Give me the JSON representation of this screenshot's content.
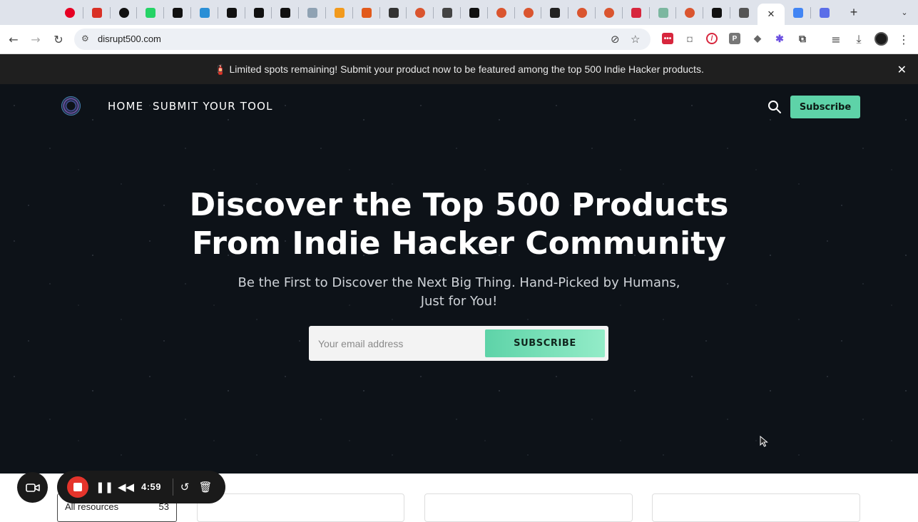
{
  "browser": {
    "tabs": [
      {
        "icon": "pinterest-tab-icon",
        "color": "#e60023"
      },
      {
        "icon": "gmail-tab-icon",
        "color": "#d93025"
      },
      {
        "icon": "threads-tab-icon",
        "color": "#111111"
      },
      {
        "icon": "whatsapp-tab-icon",
        "color": "#25d366"
      },
      {
        "icon": "x-tab-icon",
        "color": "#111111"
      },
      {
        "icon": "rainbow-tab-icon",
        "color": "#2a8fd6"
      },
      {
        "icon": "x-tab-icon",
        "color": "#111111"
      },
      {
        "icon": "x-tab-icon",
        "color": "#111111"
      },
      {
        "icon": "x-tab-icon",
        "color": "#111111"
      },
      {
        "icon": "hand-tab-icon",
        "color": "#8fa2b3"
      },
      {
        "icon": "amazon-tab-icon",
        "color": "#f29a1d"
      },
      {
        "icon": "bookmark-tab-icon",
        "color": "#e25a1c"
      },
      {
        "icon": "grid-tab-icon",
        "color": "#333333"
      },
      {
        "icon": "producthunt-tab-icon",
        "color": "#da552f"
      },
      {
        "icon": "bowl-tab-icon",
        "color": "#444444"
      },
      {
        "icon": "x-tab-icon",
        "color": "#111111"
      },
      {
        "icon": "producthunt-tab-icon",
        "color": "#da552f"
      },
      {
        "icon": "producthunt-tab-icon",
        "color": "#da552f"
      },
      {
        "icon": "news-tab-icon",
        "color": "#222222"
      },
      {
        "icon": "producthunt-tab-icon",
        "color": "#da552f"
      },
      {
        "icon": "producthunt-tab-icon",
        "color": "#da552f"
      },
      {
        "icon": "red-app-tab-icon",
        "color": "#d7263d"
      },
      {
        "icon": "image-tab-icon",
        "color": "#7cb7a0"
      },
      {
        "icon": "producthunt-tab-icon",
        "color": "#da552f"
      },
      {
        "icon": "x-tab-icon",
        "color": "#111111"
      },
      {
        "icon": "chrome-tab-icon",
        "color": "#555555"
      },
      {
        "icon": "active-close-icon",
        "color": "#333333",
        "active": true
      },
      {
        "icon": "google-tab-icon",
        "color": "#4285f4"
      },
      {
        "icon": "settings-gear-tab-icon",
        "color": "#5b6ee8"
      }
    ],
    "address": "disrupt500.com"
  },
  "announcement": {
    "text": "🧯 Limited spots remaining! Submit your product now to be featured among the top 500 Indie Hacker products."
  },
  "nav": {
    "home": "HOME",
    "submit": "SUBMIT YOUR TOOL",
    "subscribe": "Subscribe"
  },
  "hero": {
    "title": "Discover the Top 500 Products From Indie Hacker Community",
    "tagline": "Be the First to Discover the Next Big Thing. Hand-Picked by Humans, Just for You!",
    "email_placeholder": "Your email address",
    "subscribe_label": "SUBSCRIBE"
  },
  "resources": {
    "label": "All resources",
    "count": "53"
  },
  "recorder": {
    "time": "4:59",
    "stop_color": "#e5342b"
  },
  "colors": {
    "accent": "#5ed3a8",
    "hero_bg": "#0d1218",
    "announce_bg": "#1f1f1f"
  }
}
